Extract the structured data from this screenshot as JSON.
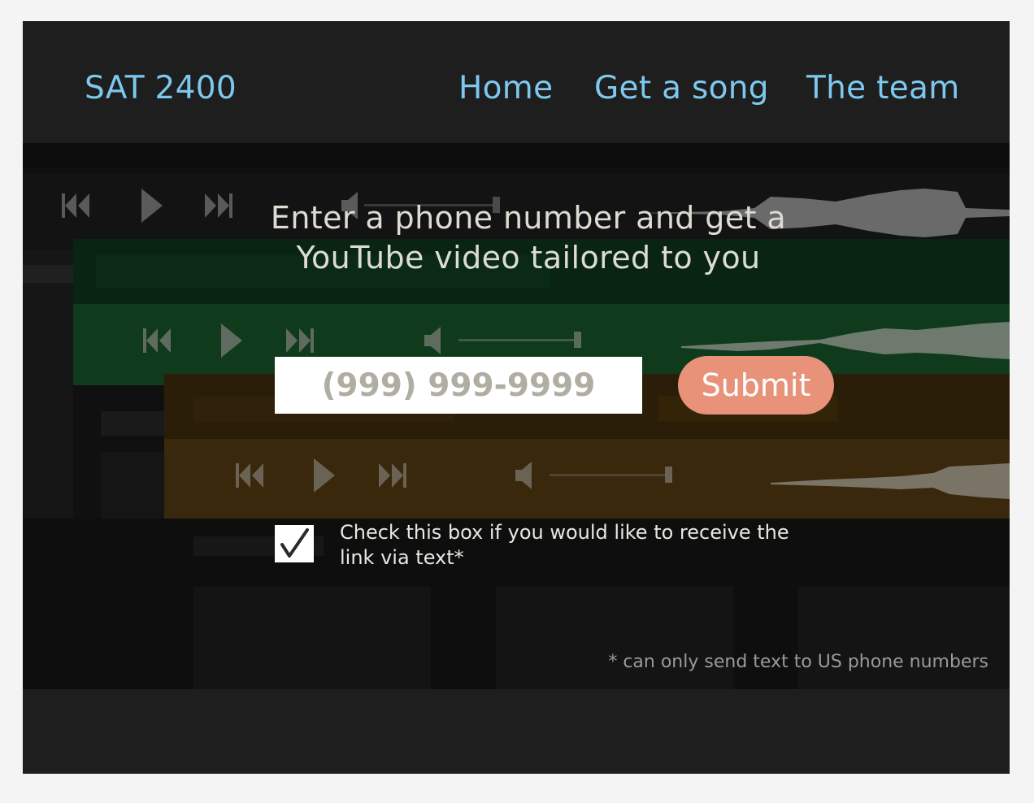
{
  "header": {
    "brand": "SAT 2400",
    "nav": [
      {
        "label": "Home"
      },
      {
        "label": "Get a song"
      },
      {
        "label": "The team"
      }
    ]
  },
  "hero": {
    "headline_line1": "Enter a phone number and get a",
    "headline_line2": "YouTube video tailored to you",
    "phone_input": {
      "placeholder": "(999) 999-9999",
      "value": ""
    },
    "submit_label": "Submit",
    "checkbox": {
      "checked": true,
      "label": "Check this box if you would like to receive the link via text*"
    },
    "footnote": "* can only send text to US phone numbers"
  },
  "colors": {
    "link": "#7cc8ee",
    "submit": "#e8927a",
    "background": "#1e1e1e"
  },
  "icons": [
    "skip-back-icon",
    "play-icon",
    "skip-forward-icon",
    "volume-icon",
    "check-icon"
  ]
}
